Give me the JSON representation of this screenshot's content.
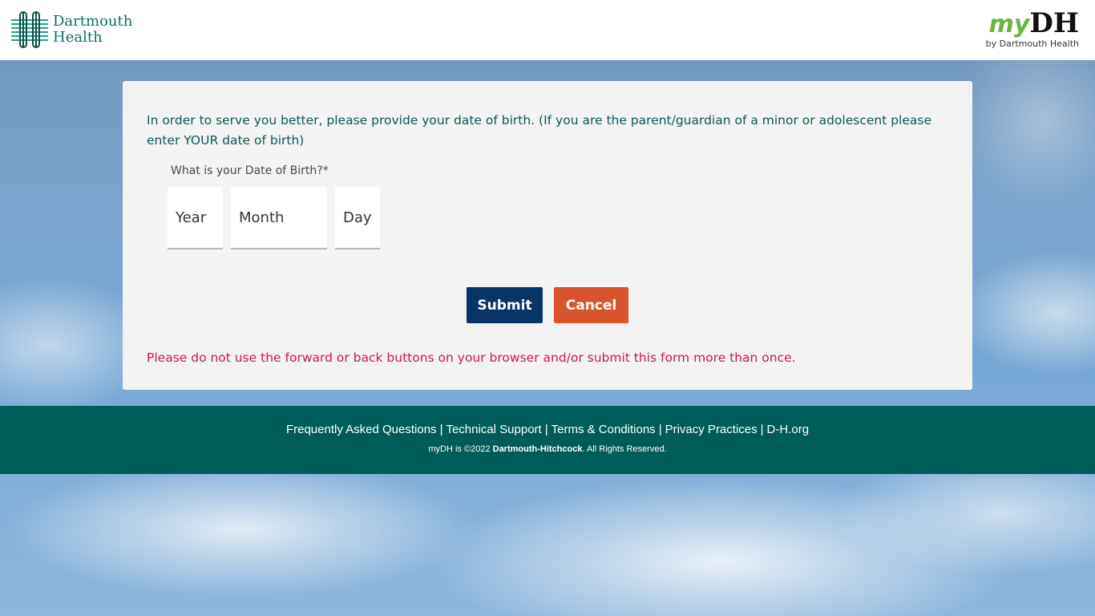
{
  "header": {
    "logo_line1": "Dartmouth",
    "logo_line2": "Health",
    "brand_my": "my",
    "brand_dh": "DH",
    "brand_sub": "by Dartmouth Health"
  },
  "form": {
    "intro": "In order to serve you better, please provide your date of birth. (If you are the parent/guardian of a minor or adolescent please enter YOUR date of birth)",
    "dob_label": "What is your Date of Birth?*",
    "year_placeholder": "Year",
    "month_placeholder": "Month",
    "day_placeholder": "Day",
    "submit_label": "Submit",
    "cancel_label": "Cancel",
    "warning": "Please do not use the forward or back buttons on your browser and/or submit this form more than once."
  },
  "footer": {
    "links": [
      "Frequently Asked Questions",
      "Technical Support",
      "Terms & Conditions",
      "Privacy Practices",
      "D-H.org"
    ],
    "separator": "|",
    "copyright_prefix": "myDH is ©2022",
    "copyright_org": "Dartmouth-Hitchcock",
    "copyright_suffix": ". All Rights Reserved."
  },
  "colors": {
    "teal": "#005c58",
    "navy_button": "#0b3466",
    "orange_button": "#d9532f",
    "warning_text": "#d0145a",
    "brand_green": "#6cb33f"
  }
}
